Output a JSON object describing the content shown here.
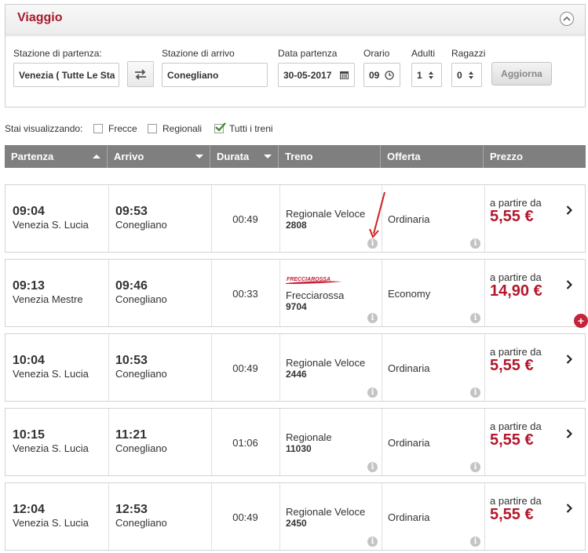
{
  "panel": {
    "title": "Viaggio",
    "labels": {
      "departure": "Stazione di partenza:",
      "arrival": "Stazione di arrivo",
      "date": "Data partenza",
      "time": "Orario",
      "adults": "Adulti",
      "children": "Ragazzi"
    },
    "values": {
      "departure": "Venezia ( Tutte Le Sta",
      "arrival": "Conegliano",
      "date": "30-05-2017",
      "time": "09",
      "adults": "1",
      "children": "0"
    },
    "update_button": "Aggiorna"
  },
  "filters": {
    "label": "Stai visualizzando:",
    "options": [
      {
        "label": "Frecce",
        "checked": false
      },
      {
        "label": "Regionali",
        "checked": false
      },
      {
        "label": "Tutti i treni",
        "checked": true
      }
    ]
  },
  "table": {
    "headers": [
      "Partenza",
      "Arrivo",
      "Durata",
      "Treno",
      "Offerta",
      "Prezzo"
    ],
    "rows": [
      {
        "dep_time": "09:04",
        "dep_station": "Venezia S. Lucia",
        "arr_time": "09:53",
        "arr_station": "Conegliano",
        "duration": "00:49",
        "train_type": "Regionale Veloce",
        "train_number": "2808",
        "offer": "Ordinaria",
        "price_label": "a partire da",
        "price": "5,55 €",
        "logo": false
      },
      {
        "dep_time": "09:13",
        "dep_station": "Venezia Mestre",
        "arr_time": "09:46",
        "arr_station": "Conegliano",
        "duration": "00:33",
        "train_type": "Frecciarossa",
        "train_number": "9704",
        "offer": "Economy",
        "price_label": "a partire da",
        "price": "14,90 €",
        "logo": true,
        "logo_text": "FRECCIAROSSA"
      },
      {
        "dep_time": "10:04",
        "dep_station": "Venezia S. Lucia",
        "arr_time": "10:53",
        "arr_station": "Conegliano",
        "duration": "00:49",
        "train_type": "Regionale Veloce",
        "train_number": "2446",
        "offer": "Ordinaria",
        "price_label": "a partire da",
        "price": "5,55 €",
        "logo": false
      },
      {
        "dep_time": "10:15",
        "dep_station": "Venezia S. Lucia",
        "arr_time": "11:21",
        "arr_station": "Conegliano",
        "duration": "01:06",
        "train_type": "Regionale",
        "train_number": "11030",
        "offer": "Ordinaria",
        "price_label": "a partire da",
        "price": "5,55 €",
        "logo": false
      },
      {
        "dep_time": "12:04",
        "dep_station": "Venezia S. Lucia",
        "arr_time": "12:53",
        "arr_station": "Conegliano",
        "duration": "00:49",
        "train_type": "Regionale Veloce",
        "train_number": "2450",
        "offer": "Ordinaria",
        "price_label": "a partire da",
        "price": "5,55 €",
        "logo": false
      }
    ]
  },
  "colors": {
    "accent": "#a51b2a",
    "price": "#b2182b",
    "header_bg": "#7f7f7f",
    "annotation_arrow": "#d11f1f"
  },
  "icons": {
    "collapse": "chevron-up-icon",
    "swap": "swap-arrows-icon",
    "calendar": "calendar-icon",
    "clock": "clock-icon",
    "spinner": "spinner-updown-icon",
    "info": "info-icon",
    "next": "chevron-right-icon",
    "more": "plus-icon"
  }
}
